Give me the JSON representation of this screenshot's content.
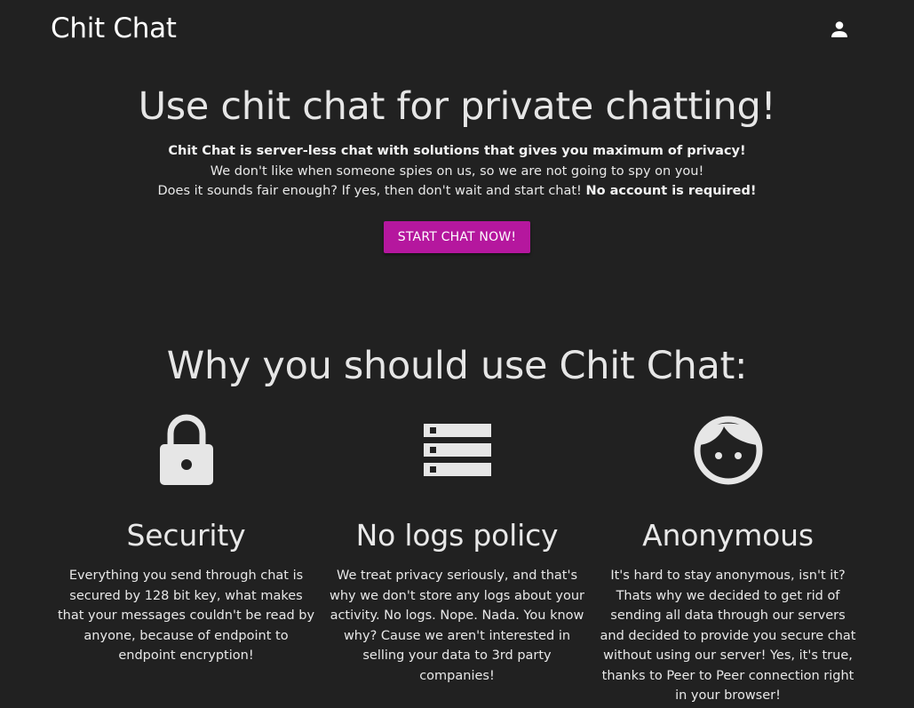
{
  "navbar": {
    "brand": "Chit Chat",
    "account_icon": "person-icon"
  },
  "hero": {
    "title": "Use chit chat for private chatting!",
    "line1_bold": "Chit Chat is server-less chat with solutions that gives you maximum of privacy!",
    "line2": "We don't like when someone spies on us, so we are not going to spy on you!",
    "line3": "Does it sounds fair enough? If yes, then don't wait and start chat!",
    "line3_bold": "No account is required!",
    "cta_label": "START CHAT NOW!"
  },
  "why": {
    "title": "Why you should use Chit Chat:"
  },
  "features": [
    {
      "icon": "lock-icon",
      "title": "Security",
      "text": "Everything you send through chat is secured by 128 bit key, what makes that your messages couldn't be read by anyone, because of endpoint to endpoint encryption!"
    },
    {
      "icon": "server-icon",
      "title": "No logs policy",
      "text": "We treat privacy seriously, and that's why we don't store any logs about your activity. No logs. Nope. Nada. You know why? Cause we aren't interested in selling your data to 3rd party companies!"
    },
    {
      "icon": "face-icon",
      "title": "Anonymous",
      "text": "It's hard to stay anonymous, isn't it? Thats why we decided to get rid of sending all data through our servers and decided to provide you secure chat without using our server! Yes, it's true, thanks to Peer to Peer connection right in your browser!"
    }
  ],
  "colors": {
    "background": "#212121",
    "accent": "#b5179e",
    "text": "#e8e8e8"
  }
}
